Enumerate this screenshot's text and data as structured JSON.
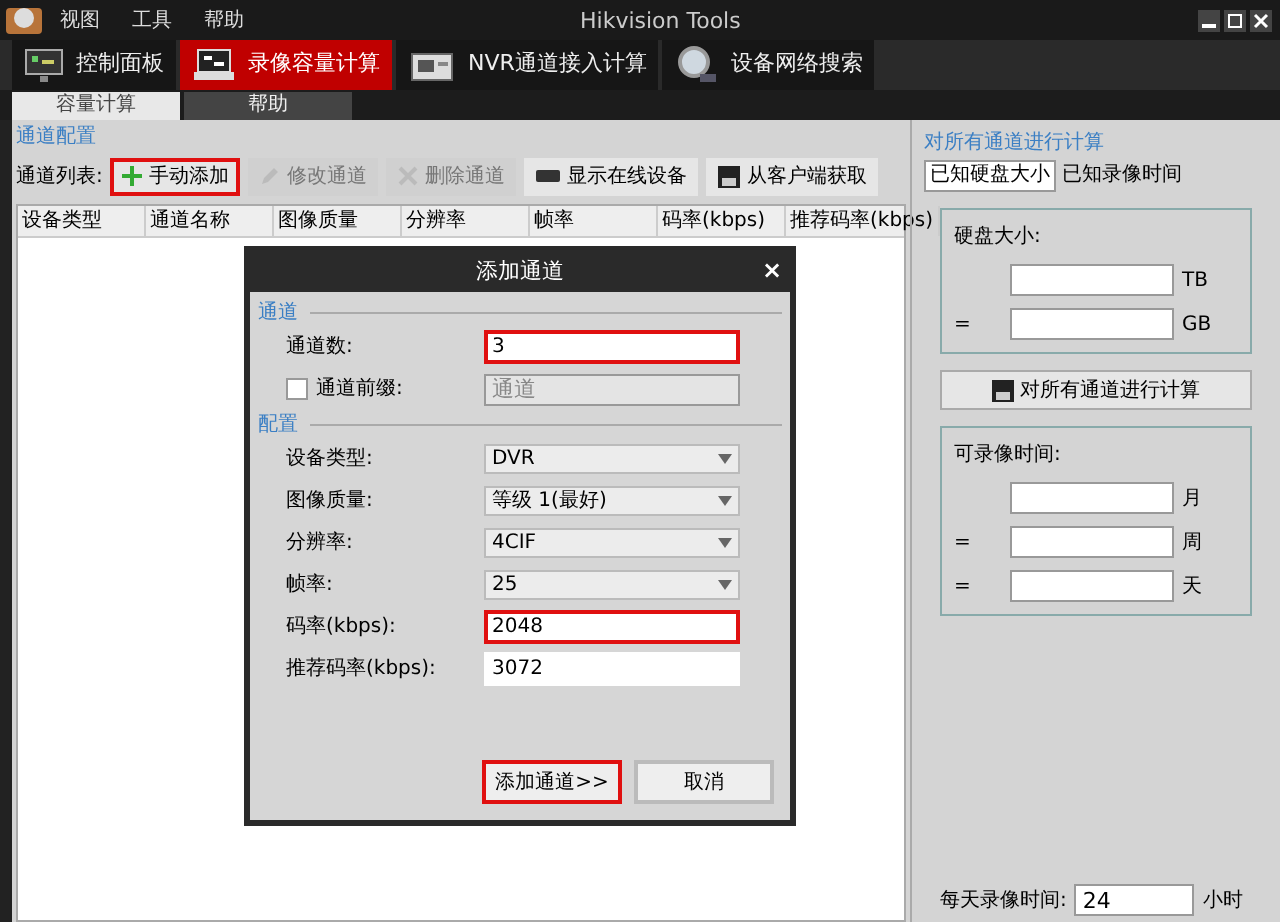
{
  "window": {
    "title": "Hikvision Tools"
  },
  "menu": [
    "视图",
    "工具",
    "帮助"
  ],
  "main_tabs": [
    {
      "label": "控制面板",
      "selected": false
    },
    {
      "label": "录像容量计算",
      "selected": true
    },
    {
      "label": "NVR通道接入计算",
      "selected": false
    },
    {
      "label": "设备网络搜索",
      "selected": false
    }
  ],
  "sub_tabs": [
    {
      "label": "容量计算",
      "selected": true
    },
    {
      "label": "帮助",
      "selected": false
    }
  ],
  "left_panel": {
    "title": "通道配置",
    "list_label": "通道列表:",
    "toolbar": [
      {
        "label": "手动添加",
        "disabled": false,
        "highlighted": true
      },
      {
        "label": "修改通道",
        "disabled": true,
        "highlighted": false
      },
      {
        "label": "删除通道",
        "disabled": true,
        "highlighted": false
      },
      {
        "label": "显示在线设备",
        "disabled": false,
        "highlighted": false
      },
      {
        "label": "从客户端获取",
        "disabled": false,
        "highlighted": false
      }
    ],
    "columns": [
      "设备类型",
      "通道名称",
      "图像质量",
      "分辨率",
      "帧率",
      "码率(kbps)",
      "推荐码率(kbps)"
    ]
  },
  "right_panel": {
    "title": "对所有通道进行计算",
    "tabs": [
      {
        "label": "已知硬盘大小",
        "selected": true
      },
      {
        "label": "已知录像时间",
        "selected": false
      }
    ],
    "disk": {
      "label": "硬盘大小:",
      "fields": [
        {
          "unit": "TB"
        },
        {
          "prefix": "=",
          "unit": "GB"
        }
      ]
    },
    "calc_button": "对所有通道进行计算",
    "time": {
      "label": "可录像时间:",
      "fields": [
        {
          "unit": "月"
        },
        {
          "prefix": "=",
          "unit": "周"
        },
        {
          "prefix": "=",
          "unit": "天"
        }
      ]
    },
    "daily": {
      "label": "每天录像时间:",
      "value": "24",
      "unit": "小时"
    }
  },
  "dialog": {
    "title": "添加通道",
    "close": "×",
    "sections": [
      {
        "title": "通道",
        "rows": [
          {
            "kind": "input",
            "label": "通道数:",
            "value": "3",
            "highlighted": true
          },
          {
            "kind": "checkbox",
            "label": "通道前缀:",
            "checked": false,
            "placeholder": "通道"
          }
        ]
      },
      {
        "title": "配置",
        "rows": [
          {
            "kind": "select",
            "label": "设备类型:",
            "value": "DVR"
          },
          {
            "kind": "select",
            "label": "图像质量:",
            "value": "等级 1(最好)"
          },
          {
            "kind": "select",
            "label": "分辨率:",
            "value": "4CIF"
          },
          {
            "kind": "select",
            "label": "帧率:",
            "value": "25"
          },
          {
            "kind": "input",
            "label": "码率(kbps):",
            "value": "2048",
            "highlighted": true
          },
          {
            "kind": "input",
            "label": "推荐码率(kbps):",
            "value": "3072",
            "highlighted": false
          }
        ]
      }
    ],
    "buttons": [
      {
        "label": "添加通道>>",
        "highlighted": true
      },
      {
        "label": "取消",
        "highlighted": false
      }
    ]
  }
}
